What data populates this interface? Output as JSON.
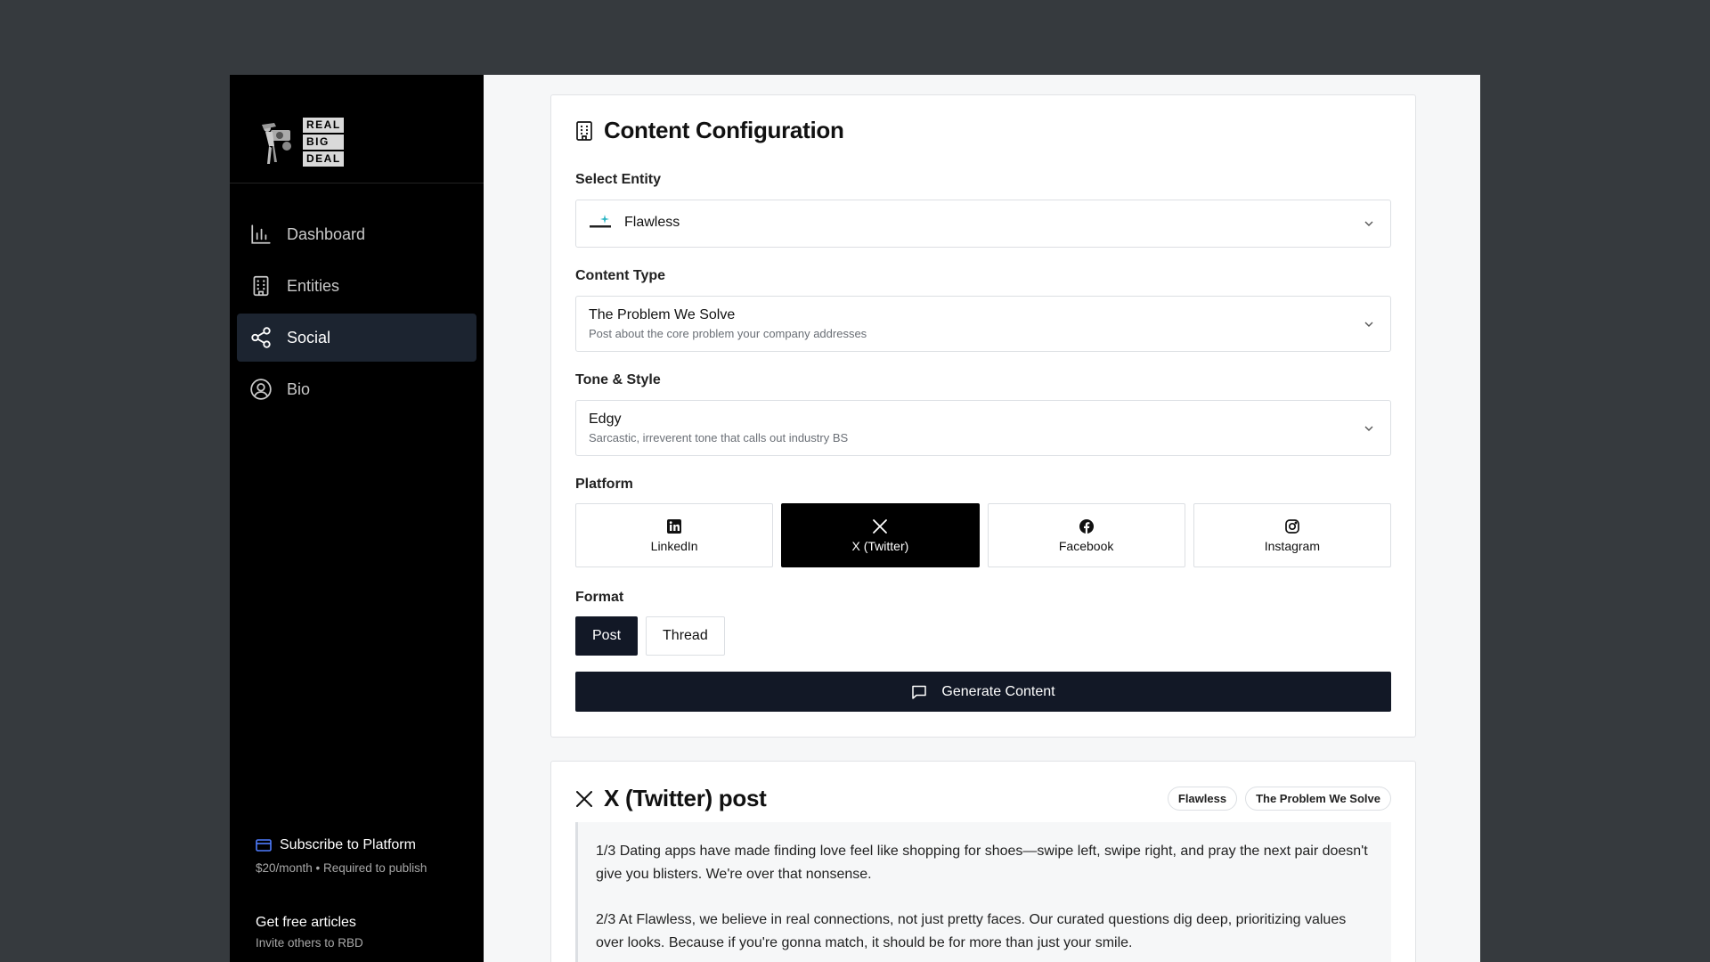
{
  "sidebar": {
    "logo_lines": [
      "REAL",
      "BIG",
      "DEAL"
    ],
    "nav": [
      {
        "label": "Dashboard",
        "icon": "bar-chart-icon",
        "active": false
      },
      {
        "label": "Entities",
        "icon": "building-icon",
        "active": false
      },
      {
        "label": "Social",
        "icon": "share-icon",
        "active": true
      },
      {
        "label": "Bio",
        "icon": "user-circle-icon",
        "active": false
      }
    ],
    "subscribe": {
      "title": "Subscribe to Platform",
      "subtitle": "$20/month • Required to publish",
      "icon": "credit-card-icon",
      "accent": "#4f7cff"
    },
    "free_articles": {
      "title": "Get free articles",
      "subtitle": "Invite others to RBD"
    }
  },
  "config": {
    "title": "Content Configuration",
    "entity": {
      "label": "Select Entity",
      "value": "Flawless"
    },
    "content_type": {
      "label": "Content Type",
      "value": "The Problem We Solve",
      "description": "Post about the core problem your company addresses"
    },
    "tone": {
      "label": "Tone & Style",
      "value": "Edgy",
      "description": "Sarcastic, irreverent tone that calls out industry BS"
    },
    "platform": {
      "label": "Platform",
      "options": [
        {
          "label": "LinkedIn",
          "icon": "linkedin-icon",
          "active": false
        },
        {
          "label": "X (Twitter)",
          "icon": "x-icon",
          "active": true
        },
        {
          "label": "Facebook",
          "icon": "facebook-icon",
          "active": false
        },
        {
          "label": "Instagram",
          "icon": "instagram-icon",
          "active": false
        }
      ]
    },
    "format": {
      "label": "Format",
      "options": [
        {
          "label": "Post",
          "active": true
        },
        {
          "label": "Thread",
          "active": false
        }
      ]
    },
    "generate_label": "Generate Content"
  },
  "post": {
    "title": "X (Twitter) post",
    "tags": [
      "Flawless",
      "The Problem We Solve"
    ],
    "paragraphs": [
      "1/3 Dating apps have made finding love feel like shopping for shoes—swipe left, swipe right, and pray the next pair doesn't give you blisters. We're over that nonsense.",
      "2/3 At Flawless, we believe in real connections, not just pretty faces. Our curated questions dig deep, prioritizing values over looks. Because if you're gonna match, it should be for more than just your smile."
    ]
  }
}
